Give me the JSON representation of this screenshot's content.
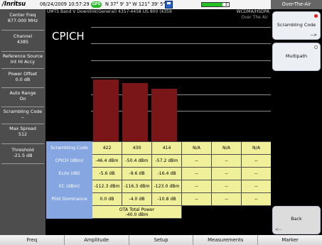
{
  "status_bar": {
    "brand": "/\nritsu",
    "datetime": "06/24/2009 10:57:29 am",
    "gps_label": "GPS",
    "coordinates": "N 37° 9' 3\" W 121° 39' 5\"",
    "battery_level": 0.75,
    "battery_indicator": "z"
  },
  "right_header": "Over-The-Air",
  "display": {
    "subtitle": "UMTS Band V Downlink(General) 4357-4458 US 800 (4359",
    "mode": "WCDMA/HSDPA",
    "ota": "Over The Air",
    "title": "CPICH"
  },
  "left_panel": [
    {
      "label": "Center Freq",
      "value": "877.000 MHz"
    },
    {
      "label": "Channel",
      "value": "4385"
    },
    {
      "label": "Reference Source",
      "value": "Int Hi Accy"
    },
    {
      "label": "Power Offset",
      "value": "0.0 dB"
    },
    {
      "label": "Auto Range",
      "value": "On"
    },
    {
      "label": "Scrambling Code",
      "value": "--"
    },
    {
      "label": "Max Spread",
      "value": "512"
    },
    {
      "label": "Threshold",
      "value": "-21.5 dB"
    }
  ],
  "right_panel": {
    "scrambling_code": {
      "label": "Scrambling Code",
      "sub": "-->",
      "active": true
    },
    "multipath": {
      "label": "Multipath",
      "active": false
    },
    "back": {
      "label": "Back",
      "sub": "<--"
    }
  },
  "chart_data": {
    "type": "bar",
    "categories": [
      "422",
      "430",
      "414"
    ],
    "values": [
      -46.4,
      -50.4,
      -57.2
    ],
    "unit": "dBm",
    "colors": [
      "#7a1518",
      "#7a1518",
      "#7a1518"
    ],
    "ylim": [
      -120,
      20
    ],
    "grid": true,
    "gridlines": 6
  },
  "table": {
    "row_headers": [
      "Scrambling Code",
      "CPICH (dBm)",
      "Ec/Io (dB)",
      "EC (dBm)",
      "Pilot Dominance"
    ],
    "columns": [
      [
        "422",
        "-46.4 dBm",
        "-5.6 dB",
        "-112.3 dBm",
        "0.0 dB"
      ],
      [
        "430",
        "-50.4 dBm",
        "-9.6 dB",
        "-116.3 dBm",
        "-4.0 dB"
      ],
      [
        "414",
        "-57.2 dBm",
        "-16.4 dB",
        "-123.0 dBm",
        "-10.8 dB"
      ],
      [
        "N/A",
        "--",
        "--",
        "--",
        "--"
      ],
      [
        "N/A",
        "--",
        "--",
        "--",
        "--"
      ],
      [
        "N/A",
        "--",
        "--",
        "--",
        "--"
      ]
    ],
    "ota_total_power_label": "OTA Total Power",
    "ota_total_power_value": "-40.0 dBm"
  },
  "bottom_menu": [
    "Freq",
    "Amplitude",
    "Setup",
    "Measurements",
    "Marker"
  ],
  "colors": {
    "bar": "#7a1518",
    "table_cell": "#f0ef9a",
    "table_header": "#85a6e0",
    "left_panel_bg": "#4d4d4d"
  }
}
